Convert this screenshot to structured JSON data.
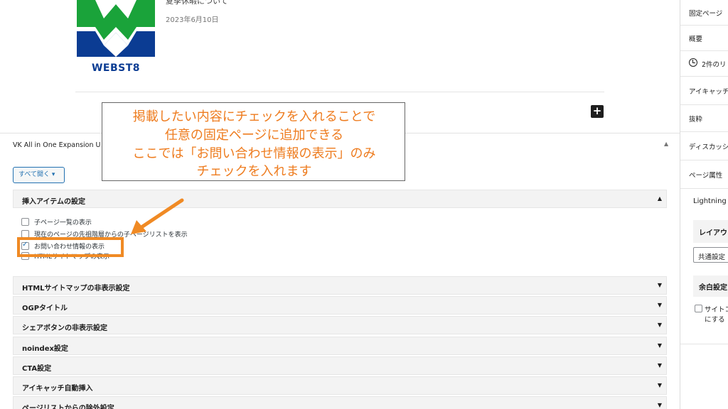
{
  "post": {
    "title": "夏季休暇について",
    "date": "2023年6月10日",
    "logo_text": "WEBST8"
  },
  "add_block_symbol": "+",
  "metabox": {
    "title": "VK All in One Expansion U",
    "expand_all_label": "すべて開く ▾",
    "collapse_symbol": "▲"
  },
  "insert_items": {
    "header": "挿入アイテムの設定",
    "arrow": "▲",
    "options": [
      {
        "label": "子ページ一覧の表示",
        "checked": false
      },
      {
        "label": "現在のページの先祖階層からの子ページリストを表示",
        "checked": false
      },
      {
        "label": "お問い合わせ情報の表示",
        "checked": true
      },
      {
        "label": "HTMLサイトマップの表示",
        "checked": false
      }
    ]
  },
  "sections": [
    {
      "label": "HTMLサイトマップの非表示設定",
      "arrow": "▼"
    },
    {
      "label": "OGPタイトル",
      "arrow": "▼"
    },
    {
      "label": "シェアボタンの非表示設定",
      "arrow": "▼"
    },
    {
      "label": "noindex設定",
      "arrow": "▼"
    },
    {
      "label": "CTA設定",
      "arrow": "▼"
    },
    {
      "label": "アイキャッチ自動挿入",
      "arrow": "▼"
    },
    {
      "label": "ページリストからの除外設定",
      "arrow": "▼"
    }
  ],
  "callout": {
    "lines": [
      "掲載したい内容にチェックを入れることで",
      "任意の固定ページに追加できる",
      "ここでは「お問い合わせ情報の表示」のみ",
      "チェックを入れます"
    ],
    "color": "#ee7c1f"
  },
  "sidebar": {
    "tab": "固定ページ",
    "items": [
      "概要",
      "2件のリ",
      "アイキャッチ",
      "抜粋",
      "ディスカッシ",
      "ページ属性"
    ],
    "lightning": "Lightning",
    "layout_header": "レイアウ",
    "layout_select": "共通設定",
    "margin_header": "余白設定",
    "margin_checkbox_line1": "サイトコ",
    "margin_checkbox_line2": "にする"
  },
  "colors": {
    "accent_orange": "#f08a24",
    "wp_blue": "#2271b1",
    "logo_green": "#1aa33a",
    "logo_blue": "#0b3c93"
  }
}
